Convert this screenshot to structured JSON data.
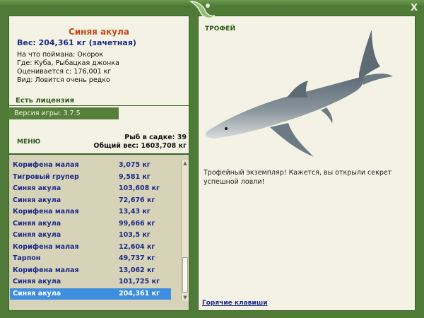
{
  "close_label": "X",
  "fish": {
    "name": "Синяя акула",
    "weight_line": "Вес: 204,361 кг (зачетная)",
    "bait": "На что поймана: Окорок",
    "place": "Где: Куба, Рыбацкая джонка",
    "value": "Оценивается с: 176,001 кг",
    "rarity": "Вид: Ловится очень редко"
  },
  "license": "Есть лицензия",
  "version": "Версия игры: 3.7.5",
  "menu_label": "МЕНЮ",
  "stats": {
    "fish_count": "Рыб в садке: 39",
    "total_weight": "Общий вес: 1603,708 кг"
  },
  "catch_list": [
    {
      "name": "Корифена малая",
      "weight": "3,075 кг"
    },
    {
      "name": "Тигровый групер",
      "weight": "9,581 кг"
    },
    {
      "name": "Синяя акула",
      "weight": "103,608 кг"
    },
    {
      "name": "Синяя акула",
      "weight": "72,676 кг"
    },
    {
      "name": "Корифена малая",
      "weight": "13,43 кг"
    },
    {
      "name": "Синяя акула",
      "weight": "99,666 кг"
    },
    {
      "name": "Синяя акула",
      "weight": "103,5 кг"
    },
    {
      "name": "Корифена малая",
      "weight": "12,604 кг"
    },
    {
      "name": "Тарпон",
      "weight": "49,737 кг"
    },
    {
      "name": "Корифена малая",
      "weight": "13,062 кг"
    },
    {
      "name": "Синяя акула",
      "weight": "101,725 кг"
    },
    {
      "name": "Синяя акула",
      "weight": "204,361 кг"
    }
  ],
  "selected_index": 11,
  "trophy": {
    "label": "ТРОФЕЙ",
    "text": "Трофейный экземпляр! Кажется, вы открыли секрет успешной ловли!"
  },
  "hotkeys_label": "Горячие клавиши",
  "colors": {
    "frame": "#4f7a38",
    "panel": "#f4f2e4",
    "list_bg": "#d7d3b8",
    "name_accent": "#c8491c",
    "list_text": "#1b2a8a",
    "selected_row": "#3d8de0"
  }
}
